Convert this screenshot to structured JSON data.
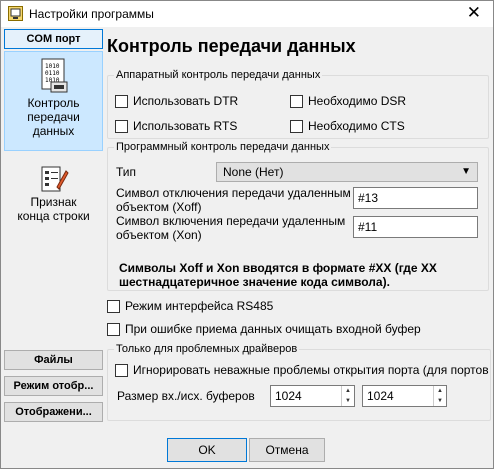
{
  "window": {
    "title": "Настройки программы",
    "close_glyph": "✕"
  },
  "nav": {
    "com_port": "COM порт",
    "items": [
      {
        "label": "Контроль передачи данных",
        "icon": "dataflow-control-icon"
      },
      {
        "label": "Признак конца строки",
        "icon": "line-end-icon"
      }
    ],
    "bottom": [
      "Файлы",
      "Режим отобр...",
      "Отображени..."
    ]
  },
  "page": {
    "title": "Контроль передачи данных",
    "hw": {
      "legend": "Аппаратный контроль передачи данных",
      "dtr": "Использовать DTR",
      "dsr": "Необходимо DSR",
      "rts": "Использовать RTS",
      "cts": "Необходимо CTS"
    },
    "sw": {
      "legend": "Программный контроль передачи данных",
      "type_label": "Тип",
      "type_value": "None (Нет)",
      "xoff_label": "Символ отключения передачи удаленным объектом (Xoff)",
      "xoff_value": "#13",
      "xon_label": "Символ включения передачи удаленным объектом (Xon)",
      "xon_value": "#11",
      "note": "Символы Xoff и Xon вводятся в формате #XX (где XX шестнадцатеричное значение кода символа)."
    },
    "rs485": "Режим интерфейса RS485",
    "clear_on_error": "При ошибке приема данных очищать входной буфер",
    "drivers": {
      "legend": "Только для проблемных драйверов",
      "ignore": "Игнорировать неважные проблемы открытия порта (для портов с проб",
      "buffers_label": "Размер вх./исх. буферов",
      "in_size": "1024",
      "out_size": "1024"
    }
  },
  "buttons": {
    "ok": "OK",
    "cancel": "Отмена"
  }
}
